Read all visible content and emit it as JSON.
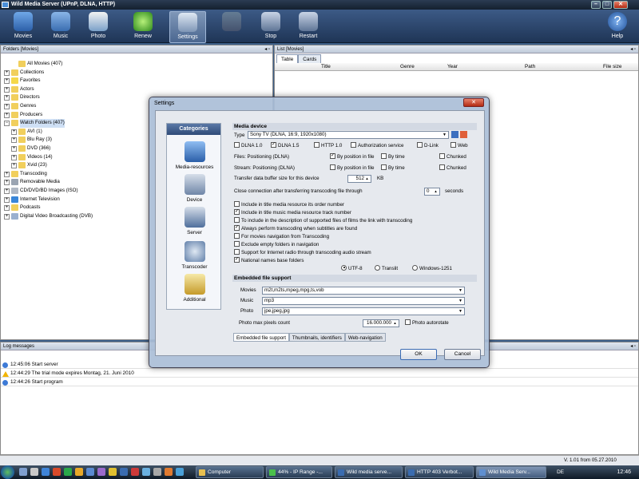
{
  "window": {
    "title": "Wild Media Server (UPnP, DLNA, HTTP)"
  },
  "toolbar": {
    "movies": "Movies",
    "music": "Music",
    "photo": "Photo",
    "renew": "Renew",
    "settings": "Settings",
    "stop": "Stop",
    "restart": "Restart",
    "help": "Help"
  },
  "folders": {
    "header": "Folders [Movies]",
    "items": [
      "All Movies (407)",
      "Collections",
      "Favorites",
      "Actors",
      "Directors",
      "Genres",
      "Producers",
      "Watch Folders (407)",
      "AVI (1)",
      "Blu Ray (3)",
      "DVD (366)",
      "Videos (14)",
      "Xvid (23)",
      "Transcoding",
      "Removable Media",
      "CD/DVD/BD Images (ISO)",
      "Internet Television",
      "Podcasts",
      "Digital Video Broadcasting (DVB)"
    ]
  },
  "list": {
    "header": "List [Movies]",
    "tabs": [
      "Table",
      "Cards"
    ],
    "columns": [
      "Title",
      "Genre",
      "Year",
      "Path",
      "File size"
    ]
  },
  "log": {
    "header": "Log messages",
    "rows": [
      "12:45:06 Start server",
      "12:44:29 The trial mode expires Montag, 21. Juni 2010",
      "12:44:26 Start program"
    ]
  },
  "status": {
    "version": "V. 1.01 from 05.27.2010"
  },
  "dialog": {
    "title": "Settings",
    "categories_header": "Categories",
    "categories": [
      "Media-resources",
      "Device",
      "Server",
      "Transcoder",
      "Additional"
    ],
    "media_device": "Media device",
    "type_label": "Type",
    "type_value": "Sony TV (DLNA, 16:9, 1920x1080)",
    "dlna10": "DLNA 1.0",
    "dlna15": "DLNA 1.5",
    "http10": "HTTP 1.0",
    "auth": "Authorization service",
    "dlink": "D-Link",
    "web": "Web",
    "files_pos": "Files: Positioning (DLNA)",
    "stream_pos": "Stream: Positioning (DLNA)",
    "by_pos": "By position in file",
    "by_time": "By time",
    "chunked": "Chunked",
    "buffer_label": "Transfer data buffer size for this device",
    "buffer_value": "512",
    "buffer_unit": "KB",
    "close_label": "Close connection after transferring transcoding file through",
    "close_value": "0",
    "close_unit": "seconds",
    "options": [
      "Include in title media resource its order number",
      "Include in title music media resource track number",
      "To include in the description of supported files of films the link with transcoding",
      "Always perform transcoding when subtitles are found",
      "For movies navigation from Transcoding",
      "Exclude empty folders in navigation",
      "Support for Internet radio through transcoding audio stream",
      "National names base folders"
    ],
    "enc": [
      "UTF-8",
      "Translit",
      "Windows-1251"
    ],
    "embedded": "Embedded file support",
    "movies_label": "Movies",
    "movies_value": "m2t,m2ts,mpeg,mpg,ts,vob",
    "music_label": "Music",
    "music_value": "mp3",
    "photo_label": "Photo",
    "photo_value": "jpe,jpeg,jpg",
    "photo_max_label": "Photo max pixels count",
    "photo_max_value": "16.000.000",
    "autorotate": "Photo autorotate",
    "bottom_tabs": [
      "Embedded file support",
      "Thumbnails, identifiers",
      "Web-navigation"
    ],
    "ok": "OK",
    "cancel": "Cancel"
  },
  "taskbar": {
    "tasks": [
      "Computer",
      "44% - IP Range -...",
      "Wild media serve...",
      "HTTP 403 Verbot...",
      "Wild Media Serv..."
    ],
    "lang": "DE",
    "time": "12:46"
  }
}
